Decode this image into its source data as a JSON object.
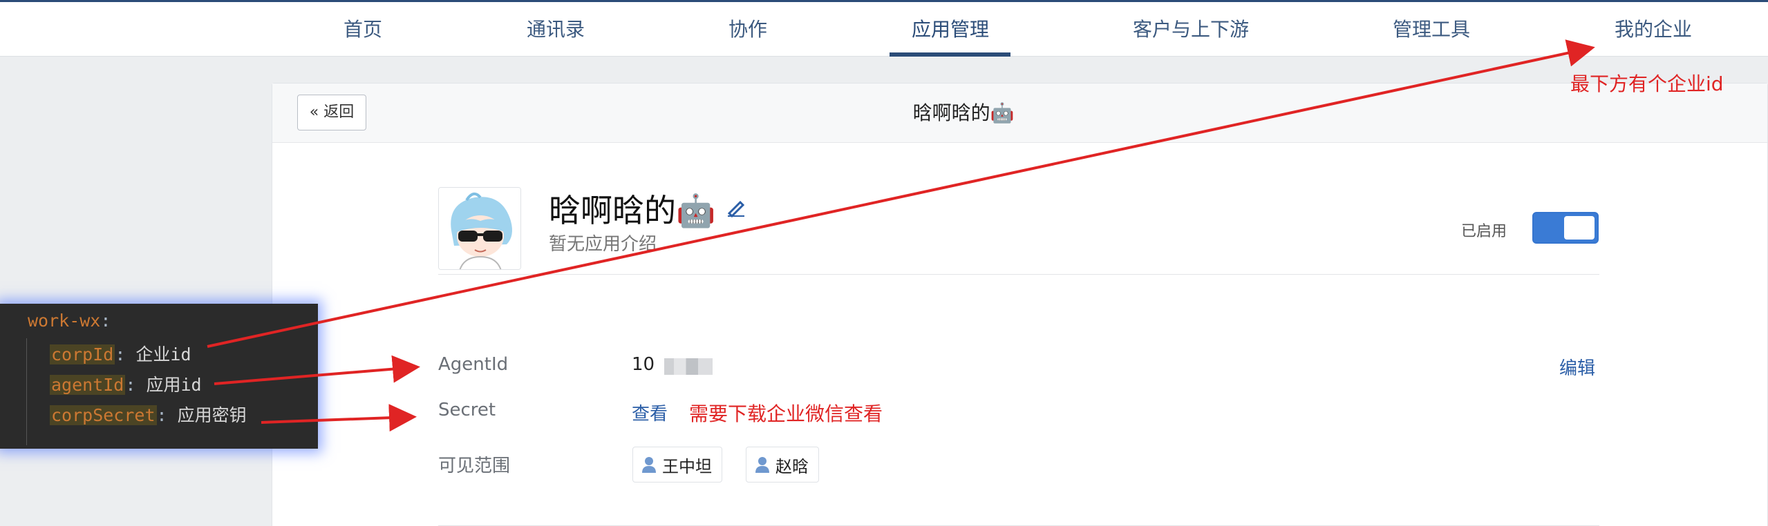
{
  "nav": {
    "items": [
      "首页",
      "通讯录",
      "协作",
      "应用管理",
      "客户与上下游",
      "管理工具",
      "我的企业"
    ],
    "active": "应用管理"
  },
  "header": {
    "back_label": "« 返回",
    "title": "晗啊晗的🤖"
  },
  "app": {
    "name": "晗啊晗的🤖",
    "description": "暂无应用介绍",
    "status_label": "已启用",
    "enabled": true
  },
  "fields": {
    "agent_id_label": "AgentId",
    "agent_id_value": "10",
    "secret_label": "Secret",
    "secret_view": "查看",
    "visibility_label": "可见范围",
    "edit_label": "编辑",
    "members": [
      "王中坦",
      "赵晗"
    ]
  },
  "annotations": {
    "corp_id_hint": "最下方有个企业id",
    "secret_hint": "需要下载企业微信查看"
  },
  "code": {
    "root": "work-wx",
    "lines": [
      {
        "key": "corpId",
        "value": "企业id"
      },
      {
        "key": "agentId",
        "value": "应用id"
      },
      {
        "key": "corpSecret",
        "value": "应用密钥"
      }
    ]
  },
  "colors": {
    "accent": "#2b4c78",
    "link": "#2b5ea7",
    "annotation": "#e02424",
    "toggle_on": "#3a7bd5"
  }
}
